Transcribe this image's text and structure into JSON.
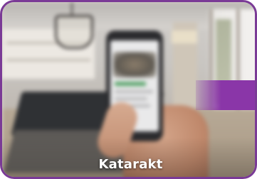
{
  "card": {
    "caption": "Katarakt",
    "border_color": "#7a3a96",
    "accent_color": "#8a36a8"
  },
  "photo": {
    "icon": "blurred-kitchen-photo-with-phone-in-hand"
  }
}
